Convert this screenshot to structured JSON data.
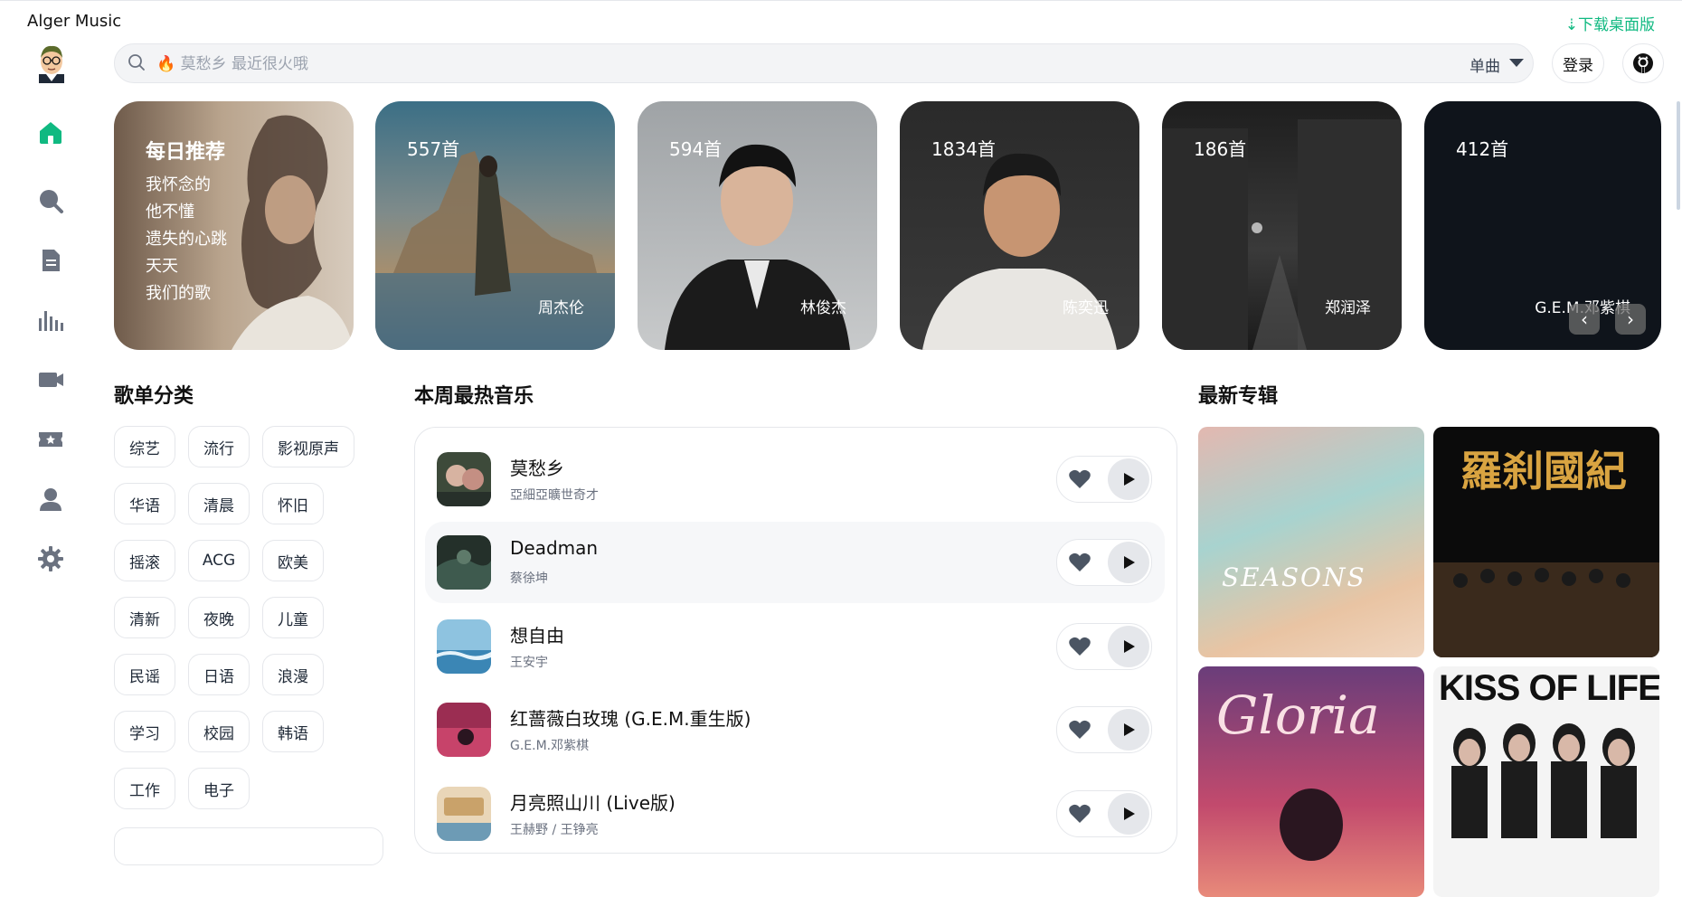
{
  "app": {
    "title": "Alger Music",
    "download_label": "⇣下载桌面版"
  },
  "sidebar": {
    "items": [
      {
        "name": "home",
        "icon": "home-icon",
        "active": true
      },
      {
        "name": "search",
        "icon": "search-icon"
      },
      {
        "name": "playlist",
        "icon": "document-icon"
      },
      {
        "name": "charts",
        "icon": "bar-chart-icon"
      },
      {
        "name": "mv",
        "icon": "video-camera-icon"
      },
      {
        "name": "favorites",
        "icon": "ticket-star-icon"
      },
      {
        "name": "user",
        "icon": "user-icon"
      },
      {
        "name": "settings",
        "icon": "gear-icon"
      }
    ]
  },
  "search": {
    "placeholder": "🔥 莫愁乡 最近很火哦",
    "type_label": "单曲"
  },
  "header": {
    "login_label": "登录"
  },
  "banner": {
    "daily": {
      "title": "每日推荐",
      "songs": [
        "我怀念的",
        "他不懂",
        "遗失的心跳",
        "天天",
        "我们的歌"
      ]
    },
    "cards": [
      {
        "count": "557首",
        "artist": "周杰伦"
      },
      {
        "count": "594首",
        "artist": "林俊杰"
      },
      {
        "count": "1834首",
        "artist": "陈奕迅"
      },
      {
        "count": "186首",
        "artist": "郑润泽"
      },
      {
        "count": "412首",
        "artist": "G.E.M.邓紫棋"
      }
    ],
    "prev_label": "‹",
    "next_label": "›"
  },
  "categories": {
    "title": "歌单分类",
    "tags": [
      "综艺",
      "流行",
      "影视原声",
      "华语",
      "清晨",
      "怀旧",
      "摇滚",
      "ACG",
      "欧美",
      "清新",
      "夜晚",
      "儿童",
      "民谣",
      "日语",
      "浪漫",
      "学习",
      "校园",
      "韩语",
      "工作",
      "电子"
    ]
  },
  "hot": {
    "title": "本周最热音乐",
    "songs": [
      {
        "name": "莫愁乡",
        "artist": "亞細亞曠世奇才"
      },
      {
        "name": "Deadman",
        "artist": "蔡徐坤"
      },
      {
        "name": "想自由",
        "artist": "王安宇"
      },
      {
        "name": "红蔷薇白玫瑰 (G.E.M.重生版)",
        "artist": "G.E.M.邓紫棋"
      },
      {
        "name": "月亮照山川 (Live版)",
        "artist": "王赫野 / 王铮亮"
      }
    ]
  },
  "albums": {
    "title": "最新专辑",
    "items": [
      {
        "text": "SEASONS"
      },
      {
        "text": "羅刹國紀"
      },
      {
        "text": "Gloria"
      },
      {
        "text": "KISS OF LIFE"
      }
    ]
  },
  "colors": {
    "accent": "#10b981",
    "border": "#e5e7eb"
  }
}
